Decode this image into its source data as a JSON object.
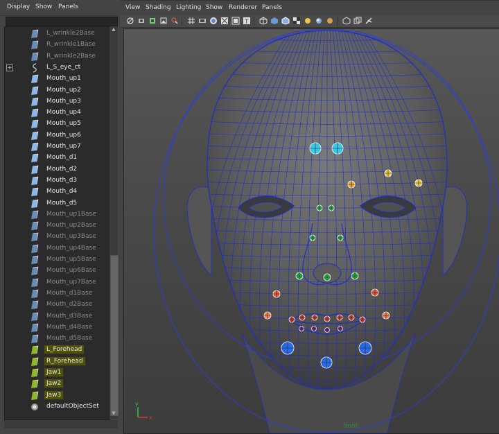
{
  "outliner": {
    "menu": [
      "Display",
      "Show",
      "Panels"
    ],
    "items": [
      {
        "label": "L_wrinkle2Base",
        "icon": "blendshape-icon",
        "dim": true
      },
      {
        "label": "R_wrinkle1Base",
        "icon": "blendshape-icon",
        "dim": true
      },
      {
        "label": "R_wrinkle2Base",
        "icon": "blendshape-icon",
        "dim": true
      },
      {
        "label": "L_S_eye_ct",
        "icon": "curve-icon",
        "dim": false,
        "expander": "+"
      },
      {
        "label": "Mouth_up1",
        "icon": "blendshape-icon",
        "dim": false
      },
      {
        "label": "Mouth_up2",
        "icon": "blendshape-icon",
        "dim": false
      },
      {
        "label": "Mouth_up3",
        "icon": "blendshape-icon",
        "dim": false
      },
      {
        "label": "Mouth_up4",
        "icon": "blendshape-icon",
        "dim": false
      },
      {
        "label": "Mouth_up5",
        "icon": "blendshape-icon",
        "dim": false
      },
      {
        "label": "Mouth_up6",
        "icon": "blendshape-icon",
        "dim": false
      },
      {
        "label": "Mouth_up7",
        "icon": "blendshape-icon",
        "dim": false
      },
      {
        "label": "Mouth_d1",
        "icon": "blendshape-icon",
        "dim": false
      },
      {
        "label": "Mouth_d2",
        "icon": "blendshape-icon",
        "dim": false
      },
      {
        "label": "Mouth_d3",
        "icon": "blendshape-icon",
        "dim": false
      },
      {
        "label": "Mouth_d4",
        "icon": "blendshape-icon",
        "dim": false
      },
      {
        "label": "Mouth_d5",
        "icon": "blendshape-icon",
        "dim": false
      },
      {
        "label": "Mouth_up1Base",
        "icon": "blendshape-icon",
        "dim": true
      },
      {
        "label": "Mouth_up2Base",
        "icon": "blendshape-icon",
        "dim": true
      },
      {
        "label": "Mouth_up3Base",
        "icon": "blendshape-icon",
        "dim": true
      },
      {
        "label": "Mouth_up4Base",
        "icon": "blendshape-icon",
        "dim": true
      },
      {
        "label": "Mouth_up5Base",
        "icon": "blendshape-icon",
        "dim": true
      },
      {
        "label": "Mouth_up6Base",
        "icon": "blendshape-icon",
        "dim": true
      },
      {
        "label": "Mouth_up7Base",
        "icon": "blendshape-icon",
        "dim": true
      },
      {
        "label": "Mouth_d1Base",
        "icon": "blendshape-icon",
        "dim": true
      },
      {
        "label": "Mouth_d2Base",
        "icon": "blendshape-icon",
        "dim": true
      },
      {
        "label": "Mouth_d3Base",
        "icon": "blendshape-icon",
        "dim": true
      },
      {
        "label": "Mouth_d4Base",
        "icon": "blendshape-icon",
        "dim": true
      },
      {
        "label": "Mouth_d5Base",
        "icon": "blendshape-icon",
        "dim": true
      },
      {
        "label": "L_Forehead",
        "icon": "blendshape-green-icon",
        "dim": false,
        "highlight": true
      },
      {
        "label": "R_Forehead",
        "icon": "blendshape-green-icon",
        "dim": false,
        "highlight": true
      },
      {
        "label": "Jaw1",
        "icon": "blendshape-green-icon",
        "dim": false,
        "highlight": true
      },
      {
        "label": "Jaw2",
        "icon": "blendshape-green-icon",
        "dim": false,
        "highlight": true
      },
      {
        "label": "Jaw3",
        "icon": "blendshape-green-icon",
        "dim": false,
        "highlight": true
      },
      {
        "label": "defaultObjectSet",
        "icon": "set-icon",
        "dim": false
      }
    ]
  },
  "viewport": {
    "menu": [
      "View",
      "Shading",
      "Lighting",
      "Show",
      "Renderer",
      "Panels"
    ],
    "camera_label": "front",
    "axis": {
      "y": "y",
      "x": "x"
    }
  },
  "colors": {
    "wire": "#1c2fc8",
    "mesh": "#5a5a5a",
    "highlight": "#4f5208"
  }
}
